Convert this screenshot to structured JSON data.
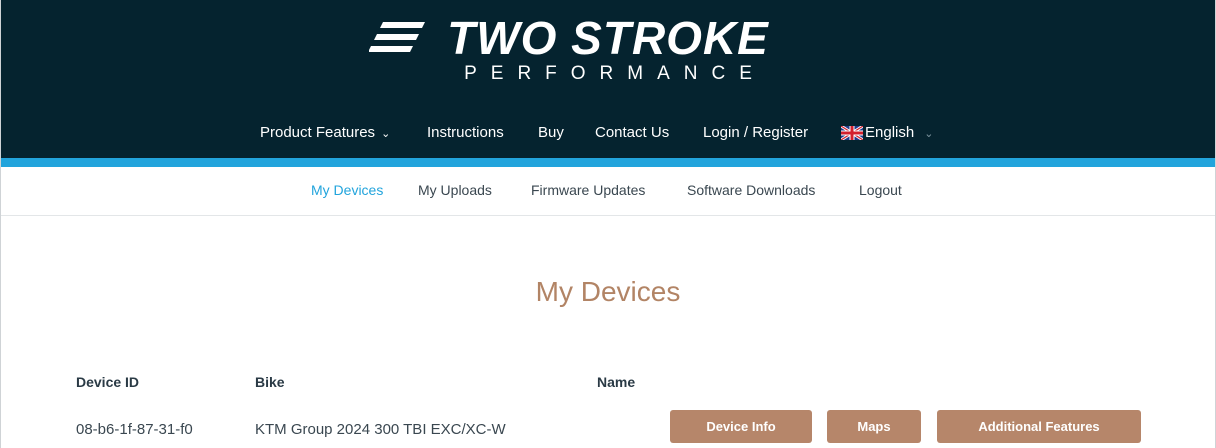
{
  "brand": {
    "name": "TWO STROKE",
    "tagline": "PERFORMANCE"
  },
  "main_nav": {
    "product_features": "Product Features",
    "instructions": "Instructions",
    "buy": "Buy",
    "contact": "Contact Us",
    "login": "Login / Register",
    "language": "English"
  },
  "sub_nav": {
    "my_devices": "My Devices",
    "my_uploads": "My Uploads",
    "firmware_updates": "Firmware Updates",
    "software_downloads": "Software Downloads",
    "logout": "Logout"
  },
  "page": {
    "title": "My Devices"
  },
  "table": {
    "headers": {
      "device_id": "Device ID",
      "bike": "Bike",
      "name": "Name"
    },
    "rows": [
      {
        "device_id": "08-b6-1f-87-31-f0",
        "bike": "KTM Group 2024 300 TBI EXC/XC-W",
        "name": ""
      }
    ]
  },
  "actions": {
    "device_info": "Device Info",
    "maps": "Maps",
    "additional_features": "Additional Features"
  },
  "colors": {
    "header_bg": "#05232f",
    "accent_blue": "#22a4dc",
    "button_brown": "#b6866a",
    "title_brown": "#b28465"
  }
}
